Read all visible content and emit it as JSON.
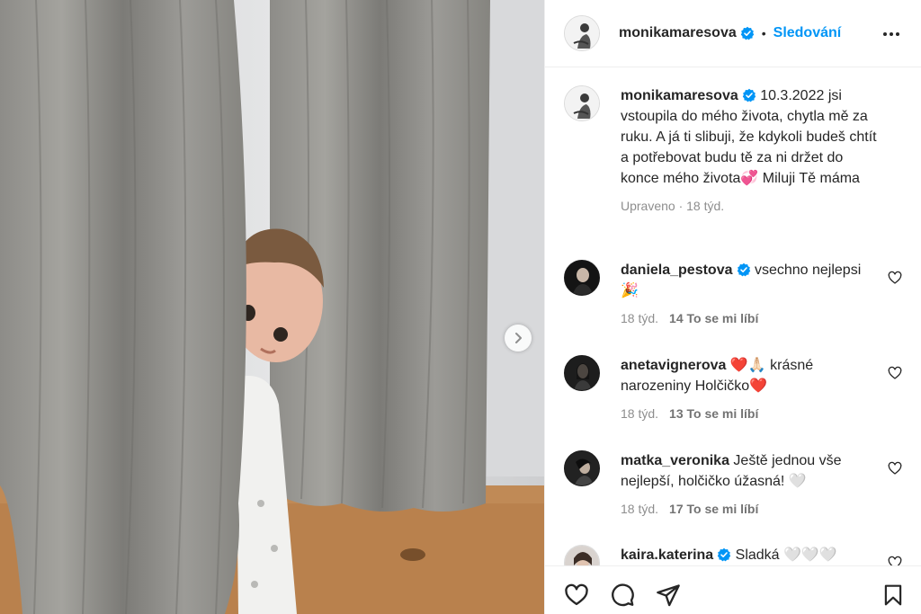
{
  "post": {
    "username": "monikamaresova",
    "verified": true,
    "separator": "•",
    "follow_label": "Sledování",
    "caption": "10.3.2022 jsi vstoupila do mého života, chytla mě za ruku. A já ti slibuji, že kdykoli budeš chtít a potřebovat budu tě za ni držet do konce mého života💞 Miluji Tě máma",
    "caption_meta": "Upraveno · 18 týd."
  },
  "comments": [
    {
      "username": "daniela_pestova",
      "verified": true,
      "text": "vsechno nejlepsi 🎉",
      "time": "18 týd.",
      "likes": "14 To se mi líbí"
    },
    {
      "username": "anetavignerova",
      "verified": false,
      "text": "❤️🙏🏻 krásné narozeniny Holčičko❤️",
      "time": "18 týd.",
      "likes": "13 To se mi líbí"
    },
    {
      "username": "matka_veronika",
      "verified": false,
      "text": "Ještě jednou vše nejlepší, holčičko úžasná! 🤍",
      "time": "18 týd.",
      "likes": "17 To se mi líbí"
    },
    {
      "username": "kaira.katerina",
      "verified": true,
      "text": "Sladká 🤍🤍🤍",
      "time": "",
      "likes": ""
    }
  ],
  "icons": {
    "verified": "verified-badge-icon",
    "more": "more-options-icon",
    "next": "chevron-right-icon",
    "like": "heart-icon",
    "comment": "comment-icon",
    "share": "paper-plane-icon",
    "save": "bookmark-icon"
  },
  "colors": {
    "accent": "#0095f6",
    "verified": "#0095f6",
    "muted": "#8e8e8e"
  }
}
